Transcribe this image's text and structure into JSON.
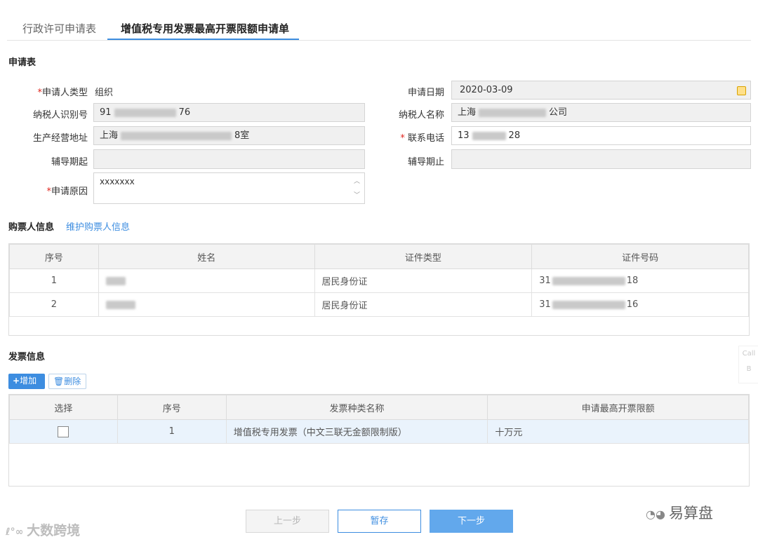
{
  "tabs": [
    {
      "label": "行政许可申请表"
    },
    {
      "label": "增值税专用发票最高开票限额申请单"
    }
  ],
  "application": {
    "section_title": "申请表",
    "applicant_type": {
      "label": "申请人类型",
      "value": "组织"
    },
    "apply_date": {
      "label": "申请日期",
      "value": "2020-03-09"
    },
    "taxpayer_id": {
      "label": "纳税人识别号",
      "prefix": "91",
      "suffix": "76"
    },
    "taxpayer_name": {
      "label": "纳税人名称",
      "prefix": "上海",
      "suffix": "公司"
    },
    "address": {
      "label": "生产经营地址",
      "prefix": "上海",
      "suffix": "8室"
    },
    "phone": {
      "label": "联系电话",
      "prefix": "13",
      "suffix": "28"
    },
    "guidance_start": {
      "label": "辅导期起",
      "value": ""
    },
    "guidance_end": {
      "label": "辅导期止",
      "value": ""
    },
    "reason": {
      "label": "申请原因",
      "value": "xxxxxxx"
    }
  },
  "buyers": {
    "section_title": "购票人信息",
    "maintain_link": "维护购票人信息",
    "columns": [
      "序号",
      "姓名",
      "证件类型",
      "证件号码"
    ],
    "rows": [
      {
        "no": "1",
        "id_type": "居民身份证",
        "id_prefix": "31",
        "id_suffix": "18"
      },
      {
        "no": "2",
        "id_type": "居民身份证",
        "id_prefix": "31",
        "id_suffix": "16"
      }
    ]
  },
  "invoices": {
    "section_title": "发票信息",
    "add_label": "增加",
    "delete_label": "删除",
    "columns": [
      "选择",
      "序号",
      "发票种类名称",
      "申请最高开票限额"
    ],
    "rows": [
      {
        "no": "1",
        "name": "增值税专用发票（中文三联无金额限制版）",
        "limit": "十万元"
      }
    ]
  },
  "buttons": {
    "prev": "上一步",
    "save": "暂存",
    "next": "下一步"
  },
  "side_widget": {
    "line1": "Call",
    "line2": "B"
  },
  "watermarks": {
    "left": "大数跨境",
    "right": "易算盘"
  },
  "colors": {
    "accent": "#3d8de0",
    "required": "#e0261e"
  }
}
